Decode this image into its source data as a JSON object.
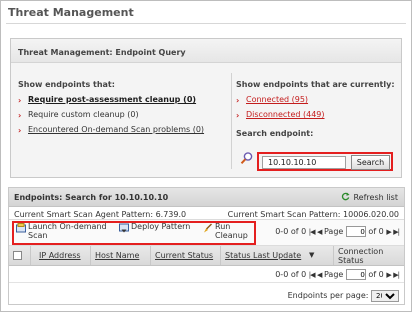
{
  "page": {
    "title": "Threat Management"
  },
  "query": {
    "title": "Threat Management: Endpoint Query",
    "show_that_heading": "Show endpoints that:",
    "that_items": [
      {
        "label": "Require post-assessment cleanup (0)"
      },
      {
        "label": "Require custom cleanup (0)"
      },
      {
        "label": "Encountered On-demand Scan problems (0)"
      }
    ],
    "current_heading": "Show endpoints that are currently:",
    "current_items": [
      {
        "label": "Connected (95)"
      },
      {
        "label": "Disconnected (449)"
      }
    ],
    "search_label": "Search endpoint:",
    "search_value": "10.10.10.10",
    "search_button": "Search"
  },
  "results": {
    "title": "Endpoints: Search for 10.10.10.10",
    "refresh": "Refresh list",
    "agent_pattern": "Current Smart Scan Agent Pattern: 6.739.0",
    "current_pattern": "Current Smart Scan Pattern: 10006.020.00",
    "toolbar": {
      "launch": "Launch On-demand Scan",
      "deploy": "Deploy Pattern",
      "run": "Run Cleanup"
    },
    "pager": {
      "range": "0-0 of 0",
      "page_label": "Page",
      "page_value": "0",
      "of_label": "of 0"
    },
    "columns": {
      "ip": "IP Address",
      "host": "Host Name",
      "status": "Current Status",
      "last_update": "Status Last Update",
      "connection": "Connection Status"
    },
    "per_page_label": "Endpoints per page:",
    "per_page_value": "20"
  },
  "colors": {
    "accent_red": "#e41f1f",
    "bullet_red": "#c41d1d",
    "link_blue": "#1a4fa3"
  },
  "icons": [
    "magnifier-icon",
    "refresh-icon",
    "scan-icon",
    "deploy-icon",
    "cleanup-icon"
  ]
}
